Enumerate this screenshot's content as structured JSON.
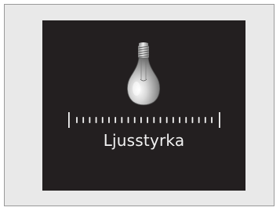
{
  "screen": {
    "label": "Ljusstyrka",
    "icon": "light-bulb-icon",
    "colors": {
      "background": "#231f20",
      "foreground": "#f2f2f2",
      "frame": "#e9e9e9"
    }
  },
  "brightness_slider": {
    "tick_count": 22
  }
}
